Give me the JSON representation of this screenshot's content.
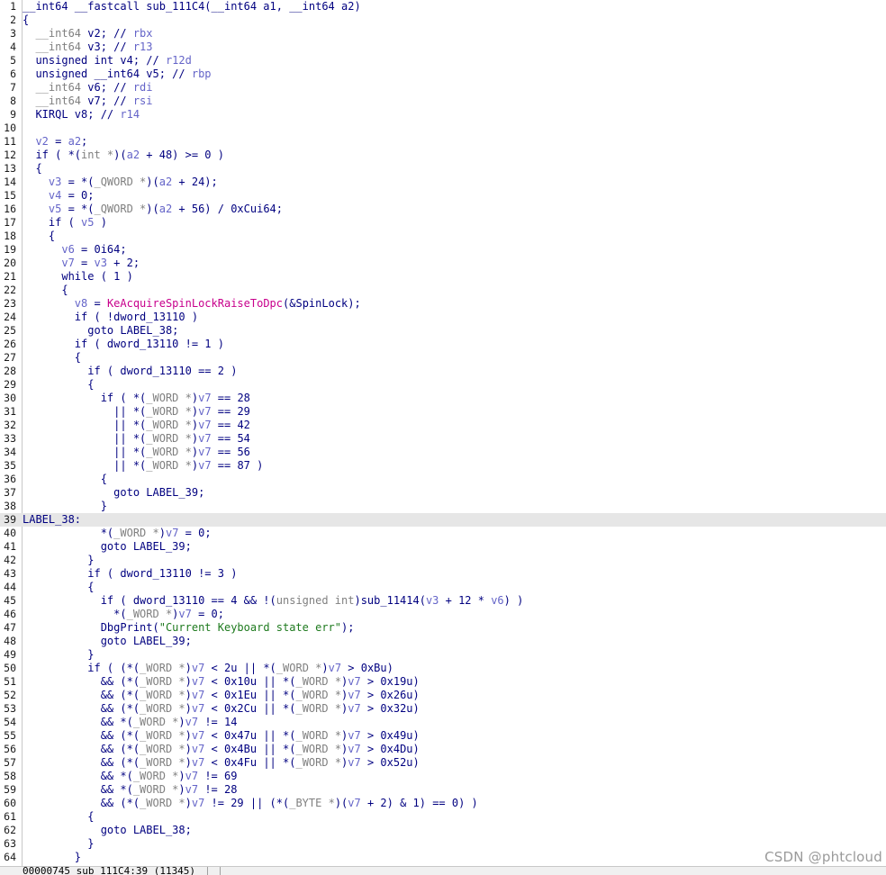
{
  "editor": {
    "highlighted_line": 39,
    "colors": {
      "plain": "#000080",
      "var": "#6464c8",
      "type": "#808080",
      "func": "#c8008c",
      "str": "#1e7a1e",
      "highlight": "#e6e6e6"
    },
    "lines": [
      [
        [
          "p",
          "__int64 __fastcall sub_111C4(__int64 a1, __int64 a2)"
        ]
      ],
      [
        [
          "p",
          "{"
        ]
      ],
      [
        [
          "t",
          "  __int64"
        ],
        [
          "p",
          " v2; // "
        ],
        [
          "v",
          "rbx"
        ]
      ],
      [
        [
          "t",
          "  __int64"
        ],
        [
          "p",
          " v3; // "
        ],
        [
          "v",
          "r13"
        ]
      ],
      [
        [
          "p",
          "  unsigned int v4; // "
        ],
        [
          "v",
          "r12d"
        ]
      ],
      [
        [
          "p",
          "  unsigned __int64 v5; // "
        ],
        [
          "v",
          "rbp"
        ]
      ],
      [
        [
          "t",
          "  __int64"
        ],
        [
          "p",
          " v6; // "
        ],
        [
          "v",
          "rdi"
        ]
      ],
      [
        [
          "t",
          "  __int64"
        ],
        [
          "p",
          " v7; // "
        ],
        [
          "v",
          "rsi"
        ]
      ],
      [
        [
          "p",
          "  KIRQL v8; // "
        ],
        [
          "v",
          "r14"
        ]
      ],
      [
        [
          "p",
          ""
        ]
      ],
      [
        [
          "v",
          "  v2"
        ],
        [
          "p",
          " = "
        ],
        [
          "v",
          "a2"
        ],
        [
          "p",
          ";"
        ]
      ],
      [
        [
          "p",
          "  if ( *("
        ],
        [
          "t",
          "int *"
        ],
        [
          "p",
          ")("
        ],
        [
          "v",
          "a2"
        ],
        [
          "p",
          " + 48) >= 0 )"
        ]
      ],
      [
        [
          "p",
          "  {"
        ]
      ],
      [
        [
          "v",
          "    v3"
        ],
        [
          "p",
          " = *("
        ],
        [
          "t",
          "_QWORD *"
        ],
        [
          "p",
          ")("
        ],
        [
          "v",
          "a2"
        ],
        [
          "p",
          " + 24);"
        ]
      ],
      [
        [
          "v",
          "    v4"
        ],
        [
          "p",
          " = 0;"
        ]
      ],
      [
        [
          "v",
          "    v5"
        ],
        [
          "p",
          " = *("
        ],
        [
          "t",
          "_QWORD *"
        ],
        [
          "p",
          ")("
        ],
        [
          "v",
          "a2"
        ],
        [
          "p",
          " + 56) / 0xCui64;"
        ]
      ],
      [
        [
          "p",
          "    if ( "
        ],
        [
          "v",
          "v5"
        ],
        [
          "p",
          " )"
        ]
      ],
      [
        [
          "p",
          "    {"
        ]
      ],
      [
        [
          "v",
          "      v6"
        ],
        [
          "p",
          " = 0i64;"
        ]
      ],
      [
        [
          "v",
          "      v7"
        ],
        [
          "p",
          " = "
        ],
        [
          "v",
          "v3"
        ],
        [
          "p",
          " + 2;"
        ]
      ],
      [
        [
          "p",
          "      while ( 1 )"
        ]
      ],
      [
        [
          "p",
          "      {"
        ]
      ],
      [
        [
          "v",
          "        v8"
        ],
        [
          "p",
          " = "
        ],
        [
          "f",
          "KeAcquireSpinLockRaiseToDpc"
        ],
        [
          "p",
          "(&SpinLock);"
        ]
      ],
      [
        [
          "p",
          "        if ( !dword_13110 )"
        ]
      ],
      [
        [
          "p",
          "          goto LABEL_38;"
        ]
      ],
      [
        [
          "p",
          "        if ( dword_13110 != 1 )"
        ]
      ],
      [
        [
          "p",
          "        {"
        ]
      ],
      [
        [
          "p",
          "          if ( dword_13110 == 2 )"
        ]
      ],
      [
        [
          "p",
          "          {"
        ]
      ],
      [
        [
          "p",
          "            if ( *("
        ],
        [
          "t",
          "_WORD *"
        ],
        [
          "p",
          ")"
        ],
        [
          "v",
          "v7"
        ],
        [
          "p",
          " == 28"
        ]
      ],
      [
        [
          "p",
          "              || *("
        ],
        [
          "t",
          "_WORD *"
        ],
        [
          "p",
          ")"
        ],
        [
          "v",
          "v7"
        ],
        [
          "p",
          " == 29"
        ]
      ],
      [
        [
          "p",
          "              || *("
        ],
        [
          "t",
          "_WORD *"
        ],
        [
          "p",
          ")"
        ],
        [
          "v",
          "v7"
        ],
        [
          "p",
          " == 42"
        ]
      ],
      [
        [
          "p",
          "              || *("
        ],
        [
          "t",
          "_WORD *"
        ],
        [
          "p",
          ")"
        ],
        [
          "v",
          "v7"
        ],
        [
          "p",
          " == 54"
        ]
      ],
      [
        [
          "p",
          "              || *("
        ],
        [
          "t",
          "_WORD *"
        ],
        [
          "p",
          ")"
        ],
        [
          "v",
          "v7"
        ],
        [
          "p",
          " == 56"
        ]
      ],
      [
        [
          "p",
          "              || *("
        ],
        [
          "t",
          "_WORD *"
        ],
        [
          "p",
          ")"
        ],
        [
          "v",
          "v7"
        ],
        [
          "p",
          " == 87 )"
        ]
      ],
      [
        [
          "p",
          "            {"
        ]
      ],
      [
        [
          "p",
          "              goto LABEL_39;"
        ]
      ],
      [
        [
          "p",
          "            }"
        ]
      ],
      [
        [
          "p",
          "LABEL_38:"
        ]
      ],
      [
        [
          "p",
          "            *("
        ],
        [
          "t",
          "_WORD *"
        ],
        [
          "p",
          ")"
        ],
        [
          "v",
          "v7"
        ],
        [
          "p",
          " = 0;"
        ]
      ],
      [
        [
          "p",
          "            goto LABEL_39;"
        ]
      ],
      [
        [
          "p",
          "          }"
        ]
      ],
      [
        [
          "p",
          "          if ( dword_13110 != 3 )"
        ]
      ],
      [
        [
          "p",
          "          {"
        ]
      ],
      [
        [
          "p",
          "            if ( dword_13110 == 4 && !("
        ],
        [
          "t",
          "unsigned int"
        ],
        [
          "p",
          ")sub_11414("
        ],
        [
          "v",
          "v3"
        ],
        [
          "p",
          " + 12 * "
        ],
        [
          "v",
          "v6"
        ],
        [
          "p",
          ") )"
        ]
      ],
      [
        [
          "p",
          "              *("
        ],
        [
          "t",
          "_WORD *"
        ],
        [
          "p",
          ")"
        ],
        [
          "v",
          "v7"
        ],
        [
          "p",
          " = 0;"
        ]
      ],
      [
        [
          "p",
          "            DbgPrint("
        ],
        [
          "s",
          "\"Current Keyboard state err\""
        ],
        [
          "p",
          ");"
        ]
      ],
      [
        [
          "p",
          "            goto LABEL_39;"
        ]
      ],
      [
        [
          "p",
          "          }"
        ]
      ],
      [
        [
          "p",
          "          if ( (*("
        ],
        [
          "t",
          "_WORD *"
        ],
        [
          "p",
          ")"
        ],
        [
          "v",
          "v7"
        ],
        [
          "p",
          " < 2u || *("
        ],
        [
          "t",
          "_WORD *"
        ],
        [
          "p",
          ")"
        ],
        [
          "v",
          "v7"
        ],
        [
          "p",
          " > 0xBu)"
        ]
      ],
      [
        [
          "p",
          "            && (*("
        ],
        [
          "t",
          "_WORD *"
        ],
        [
          "p",
          ")"
        ],
        [
          "v",
          "v7"
        ],
        [
          "p",
          " < 0x10u || *("
        ],
        [
          "t",
          "_WORD *"
        ],
        [
          "p",
          ")"
        ],
        [
          "v",
          "v7"
        ],
        [
          "p",
          " > 0x19u)"
        ]
      ],
      [
        [
          "p",
          "            && (*("
        ],
        [
          "t",
          "_WORD *"
        ],
        [
          "p",
          ")"
        ],
        [
          "v",
          "v7"
        ],
        [
          "p",
          " < 0x1Eu || *("
        ],
        [
          "t",
          "_WORD *"
        ],
        [
          "p",
          ")"
        ],
        [
          "v",
          "v7"
        ],
        [
          "p",
          " > 0x26u)"
        ]
      ],
      [
        [
          "p",
          "            && (*("
        ],
        [
          "t",
          "_WORD *"
        ],
        [
          "p",
          ")"
        ],
        [
          "v",
          "v7"
        ],
        [
          "p",
          " < 0x2Cu || *("
        ],
        [
          "t",
          "_WORD *"
        ],
        [
          "p",
          ")"
        ],
        [
          "v",
          "v7"
        ],
        [
          "p",
          " > 0x32u)"
        ]
      ],
      [
        [
          "p",
          "            && *("
        ],
        [
          "t",
          "_WORD *"
        ],
        [
          "p",
          ")"
        ],
        [
          "v",
          "v7"
        ],
        [
          "p",
          " != 14"
        ]
      ],
      [
        [
          "p",
          "            && (*("
        ],
        [
          "t",
          "_WORD *"
        ],
        [
          "p",
          ")"
        ],
        [
          "v",
          "v7"
        ],
        [
          "p",
          " < 0x47u || *("
        ],
        [
          "t",
          "_WORD *"
        ],
        [
          "p",
          ")"
        ],
        [
          "v",
          "v7"
        ],
        [
          "p",
          " > 0x49u)"
        ]
      ],
      [
        [
          "p",
          "            && (*("
        ],
        [
          "t",
          "_WORD *"
        ],
        [
          "p",
          ")"
        ],
        [
          "v",
          "v7"
        ],
        [
          "p",
          " < 0x4Bu || *("
        ],
        [
          "t",
          "_WORD *"
        ],
        [
          "p",
          ")"
        ],
        [
          "v",
          "v7"
        ],
        [
          "p",
          " > 0x4Du)"
        ]
      ],
      [
        [
          "p",
          "            && (*("
        ],
        [
          "t",
          "_WORD *"
        ],
        [
          "p",
          ")"
        ],
        [
          "v",
          "v7"
        ],
        [
          "p",
          " < 0x4Fu || *("
        ],
        [
          "t",
          "_WORD *"
        ],
        [
          "p",
          ")"
        ],
        [
          "v",
          "v7"
        ],
        [
          "p",
          " > 0x52u)"
        ]
      ],
      [
        [
          "p",
          "            && *("
        ],
        [
          "t",
          "_WORD *"
        ],
        [
          "p",
          ")"
        ],
        [
          "v",
          "v7"
        ],
        [
          "p",
          " != 69"
        ]
      ],
      [
        [
          "p",
          "            && *("
        ],
        [
          "t",
          "_WORD *"
        ],
        [
          "p",
          ")"
        ],
        [
          "v",
          "v7"
        ],
        [
          "p",
          " != 28"
        ]
      ],
      [
        [
          "p",
          "            && (*("
        ],
        [
          "t",
          "_WORD *"
        ],
        [
          "p",
          ")"
        ],
        [
          "v",
          "v7"
        ],
        [
          "p",
          " != 29 || (*("
        ],
        [
          "t",
          "_BYTE *"
        ],
        [
          "p",
          ")("
        ],
        [
          "v",
          "v7"
        ],
        [
          "p",
          " + 2) & 1) == 0) )"
        ]
      ],
      [
        [
          "p",
          "          {"
        ]
      ],
      [
        [
          "p",
          "            goto LABEL_38;"
        ]
      ],
      [
        [
          "p",
          "          }"
        ]
      ],
      [
        [
          "p",
          "        }"
        ]
      ]
    ]
  },
  "status": {
    "text": "00000745 sub_111C4:39 (11345)"
  },
  "watermark": "CSDN @phtcloud"
}
